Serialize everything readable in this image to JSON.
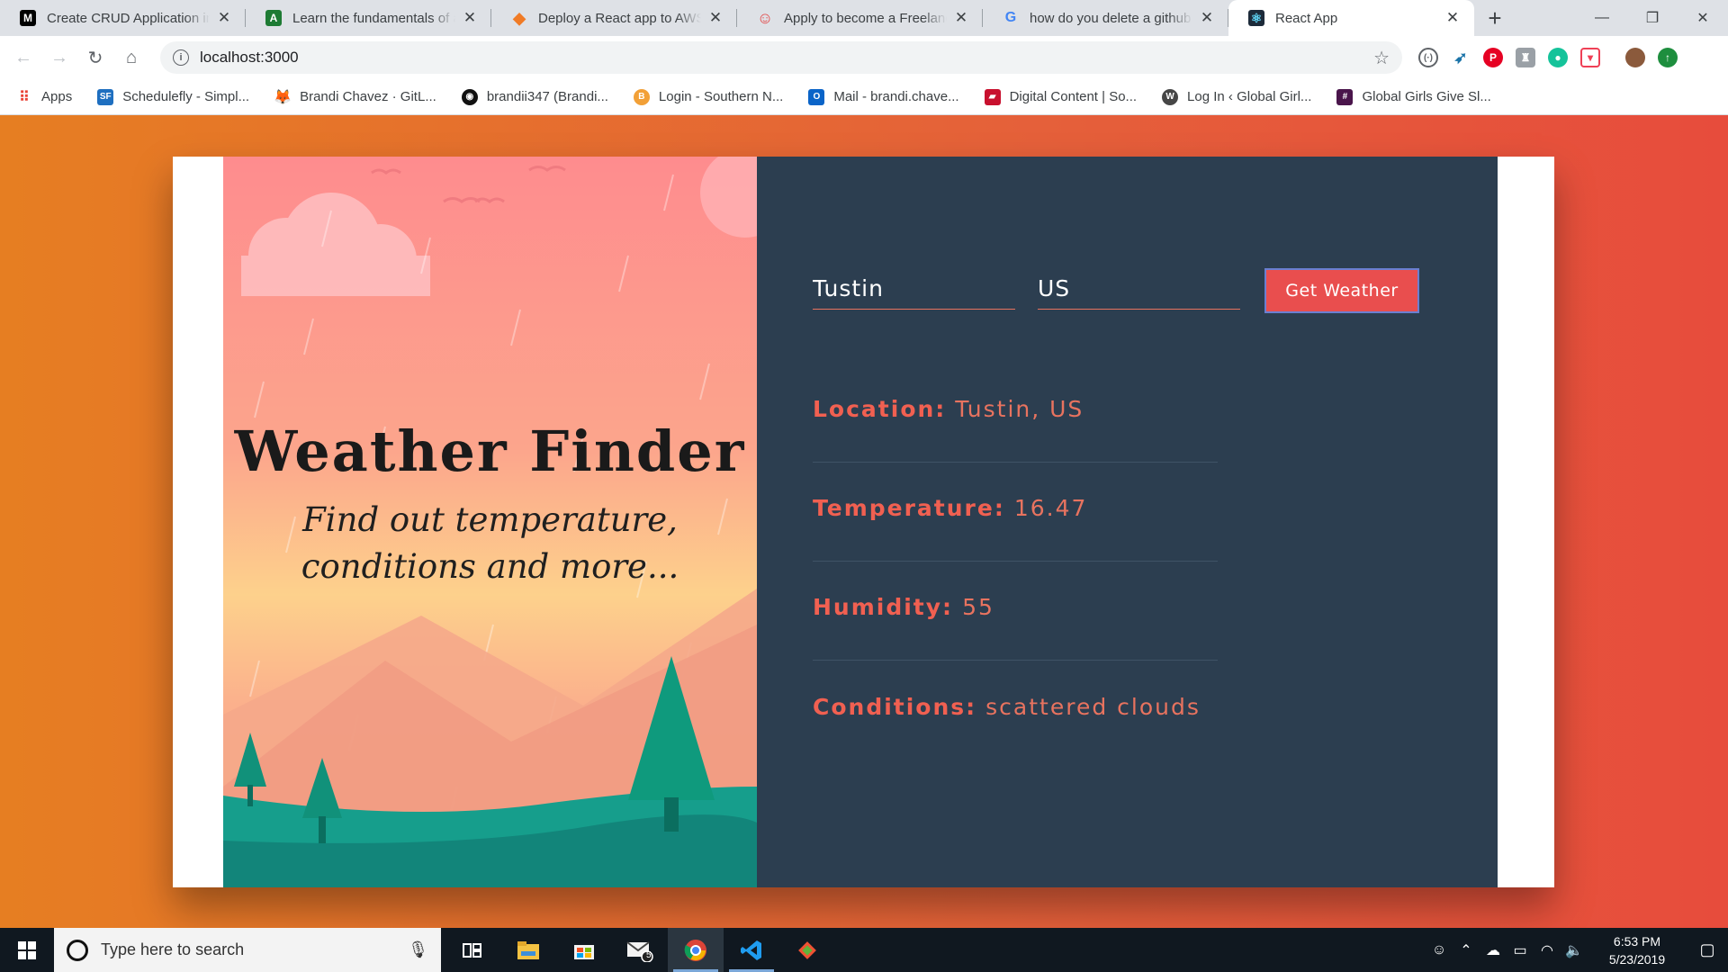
{
  "browser": {
    "tabs": [
      {
        "title": "Create CRUD Application in E",
        "favicon": "M",
        "favicon_color": "#000000",
        "active": false
      },
      {
        "title": "Learn the fundamentals of a",
        "favicon": "A",
        "favicon_color": "#1e7b34",
        "active": false
      },
      {
        "title": "Deploy a React app to AWS w",
        "favicon": "◆",
        "favicon_color": "#f07b26",
        "active": false
      },
      {
        "title": "Apply to become a Freelance",
        "favicon": "☺",
        "favicon_color": "#e34b4b",
        "active": false
      },
      {
        "title": "how do you delete a github r",
        "favicon": "G",
        "favicon_color": "#4285f4",
        "active": false
      },
      {
        "title": "React App",
        "favicon": "⚛",
        "favicon_color": "#1d2b3a",
        "active": true
      }
    ],
    "new_tab_icon": "+",
    "address": "localhost:3000",
    "bookmarks": [
      {
        "label": "Apps",
        "icon": "apps-grid-icon",
        "color": "#e94235"
      },
      {
        "label": "Schedulefly - Simpl...",
        "icon": "SF",
        "color": "#1e6fc0"
      },
      {
        "label": "Brandi Chavez · GitL...",
        "icon": "gitlab-icon",
        "color": "#e24329"
      },
      {
        "label": "brandii347 (Brandi...",
        "icon": "github-icon",
        "color": "#111111"
      },
      {
        "label": "Login - Southern N...",
        "icon": "B",
        "color": "#f2a037"
      },
      {
        "label": "Mail - brandi.chave...",
        "icon": "O",
        "color": "#0a64c8"
      },
      {
        "label": "Digital Content | So...",
        "icon": "book-icon",
        "color": "#c8102e"
      },
      {
        "label": "Log In ‹ Global Girl...",
        "icon": "wordpress-icon",
        "color": "#464646"
      },
      {
        "label": "Global Girls Give Sl...",
        "icon": "slack-icon",
        "color": "#4a154b"
      }
    ]
  },
  "app": {
    "title": "Weather Finder",
    "subtitle": "Find out temperature, conditions and more...",
    "city_value": "Tustin",
    "country_value": "US",
    "button_label": "Get Weather",
    "results": [
      {
        "key": "Location:",
        "value": "Tustin, US"
      },
      {
        "key": "Temperature:",
        "value": "16.47"
      },
      {
        "key": "Humidity:",
        "value": "55"
      },
      {
        "key": "Conditions:",
        "value": "scattered clouds"
      }
    ]
  },
  "taskbar": {
    "search_placeholder": "Type here to search",
    "mail_badge": "5",
    "time": "6:53 PM",
    "date": "5/23/2019"
  }
}
